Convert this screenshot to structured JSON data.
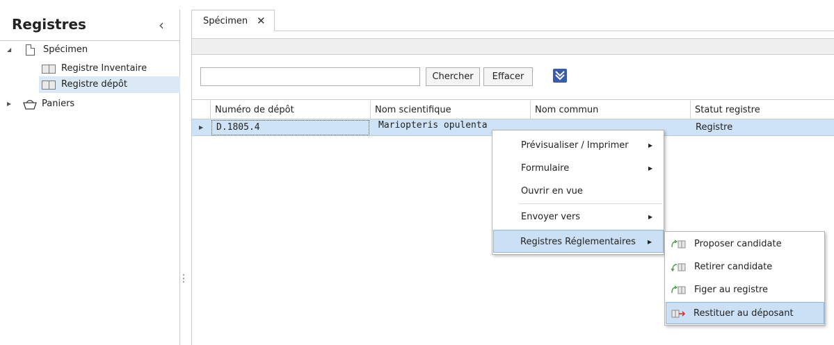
{
  "sidebar": {
    "title": "Registres",
    "collapse_icon": "chevron-left-icon",
    "tree": [
      {
        "label": "Spécimen",
        "icon": "document-icon",
        "expanded": true
      },
      {
        "label": "Registre Inventaire",
        "icon": "book-icon"
      },
      {
        "label": "Registre dépôt",
        "icon": "book-icon",
        "selected": true
      },
      {
        "label": "Paniers",
        "icon": "basket-icon",
        "expanded": false
      }
    ]
  },
  "tabs": [
    {
      "label": "Spécimen",
      "close_glyph": "✕",
      "active": true
    }
  ],
  "search": {
    "value": "",
    "search_label": "Chercher",
    "clear_label": "Effacer",
    "expand_icon": "double-chevron-down-icon"
  },
  "grid": {
    "columns": [
      "Numéro de dépôt",
      "Nom scientifique",
      "Nom commun",
      "Statut registre"
    ],
    "rows": [
      {
        "numero_depot": "D.1805.4",
        "nom_scientifique": "Mariopteris opulenta",
        "nom_commun": "",
        "statut_registre": "Registre",
        "selected": true
      }
    ]
  },
  "context_menu": {
    "items": [
      {
        "label": "Prévisualiser / Imprimer",
        "submenu": true
      },
      {
        "label": "Formulaire",
        "submenu": true
      },
      {
        "label": "Ouvrir en vue",
        "submenu": false
      },
      {
        "label": "Envoyer vers",
        "submenu": true
      },
      {
        "label": "Registres Réglementaires",
        "submenu": true,
        "highlighted": true
      }
    ],
    "submenu": [
      {
        "label": "Proposer candidate",
        "icon": "propose-icon"
      },
      {
        "label": "Retirer candidate",
        "icon": "withdraw-icon"
      },
      {
        "label": "Figer au registre",
        "icon": "freeze-icon"
      },
      {
        "label": "Restituer au déposant",
        "icon": "return-icon",
        "highlighted": true
      }
    ]
  },
  "colors": {
    "selection": "#cfe3f7",
    "menu_highlight": "#cce0f5",
    "accent": "#3b5cab"
  }
}
